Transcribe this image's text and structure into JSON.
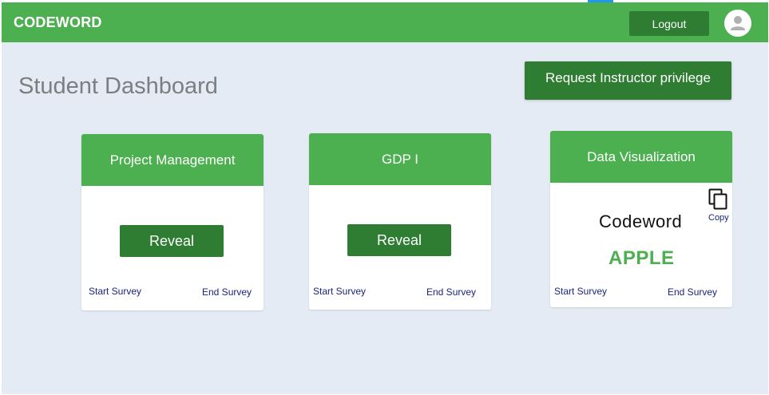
{
  "app": {
    "brand": "CODEWORD"
  },
  "header": {
    "logout_label": "Logout"
  },
  "page": {
    "title": "Student Dashboard",
    "request_button_label": "Request Instructor privilege"
  },
  "cards": [
    {
      "title": "Project Management",
      "reveal_label": "Reveal",
      "start_survey": "Start Survey",
      "end_survey": "End Survey"
    },
    {
      "title": "GDP I",
      "reveal_label": "Reveal",
      "start_survey": "Start Survey",
      "end_survey": "End Survey"
    },
    {
      "title": "Data Visualization",
      "codeword_label": "Codeword",
      "codeword_value": "APPLE",
      "copy_label": "Copy",
      "start_survey": "Start Survey",
      "end_survey": "End Survey"
    }
  ],
  "icons": {
    "avatar": "account-circle-icon",
    "copy": "copy-icon"
  },
  "colors": {
    "primary": "#4caf50",
    "primary_dark": "#2e7d32",
    "background": "#e5ebf4",
    "link": "#1a237e"
  }
}
